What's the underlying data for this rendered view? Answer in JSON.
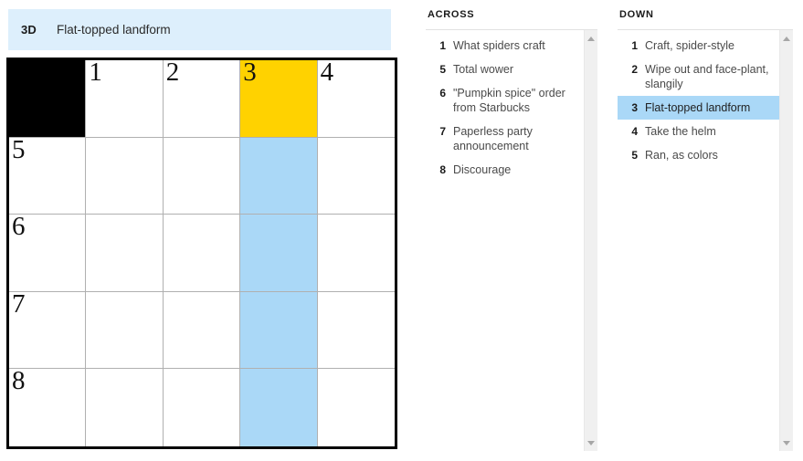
{
  "current_clue": {
    "ref": "3D",
    "text": "Flat-topped landform"
  },
  "colors": {
    "banner_bg": "#ddeffc",
    "cursor_cell": "#ffd200",
    "highlight_word": "#aad8f7",
    "block": "#000000",
    "grid_border": "#000000",
    "cell_border": "#b0b0b0"
  },
  "grid": {
    "rows": 5,
    "cols": 5,
    "cells": [
      {
        "number": "",
        "letter": "",
        "state": "block"
      },
      {
        "number": "1",
        "letter": "",
        "state": "empty"
      },
      {
        "number": "2",
        "letter": "",
        "state": "empty"
      },
      {
        "number": "3",
        "letter": "",
        "state": "cursor"
      },
      {
        "number": "4",
        "letter": "",
        "state": "empty"
      },
      {
        "number": "5",
        "letter": "",
        "state": "empty"
      },
      {
        "number": "",
        "letter": "",
        "state": "empty"
      },
      {
        "number": "",
        "letter": "",
        "state": "empty"
      },
      {
        "number": "",
        "letter": "",
        "state": "highlight"
      },
      {
        "number": "",
        "letter": "",
        "state": "empty"
      },
      {
        "number": "6",
        "letter": "",
        "state": "empty"
      },
      {
        "number": "",
        "letter": "",
        "state": "empty"
      },
      {
        "number": "",
        "letter": "",
        "state": "empty"
      },
      {
        "number": "",
        "letter": "",
        "state": "highlight"
      },
      {
        "number": "",
        "letter": "",
        "state": "empty"
      },
      {
        "number": "7",
        "letter": "",
        "state": "empty"
      },
      {
        "number": "",
        "letter": "",
        "state": "empty"
      },
      {
        "number": "",
        "letter": "",
        "state": "empty"
      },
      {
        "number": "",
        "letter": "",
        "state": "highlight"
      },
      {
        "number": "",
        "letter": "",
        "state": "empty"
      },
      {
        "number": "8",
        "letter": "",
        "state": "empty"
      },
      {
        "number": "",
        "letter": "",
        "state": "empty"
      },
      {
        "number": "",
        "letter": "",
        "state": "empty"
      },
      {
        "number": "",
        "letter": "",
        "state": "highlight"
      },
      {
        "number": "",
        "letter": "",
        "state": "empty"
      }
    ]
  },
  "across": {
    "title": "ACROSS",
    "clues": [
      {
        "number": "1",
        "text": "What spiders craft",
        "state": "cursor"
      },
      {
        "number": "5",
        "text": "Total wower",
        "state": "normal"
      },
      {
        "number": "6",
        "text": "\"Pumpkin spice\" order from Starbucks",
        "state": "normal"
      },
      {
        "number": "7",
        "text": "Paperless party announcement",
        "state": "normal"
      },
      {
        "number": "8",
        "text": "Discourage",
        "state": "normal"
      }
    ]
  },
  "down": {
    "title": "DOWN",
    "clues": [
      {
        "number": "1",
        "text": "Craft, spider-style",
        "state": "normal"
      },
      {
        "number": "2",
        "text": "Wipe out and face-plant, slangily",
        "state": "normal"
      },
      {
        "number": "3",
        "text": "Flat-topped landform",
        "state": "selected"
      },
      {
        "number": "4",
        "text": "Take the helm",
        "state": "normal"
      },
      {
        "number": "5",
        "text": "Ran, as colors",
        "state": "normal"
      }
    ]
  },
  "scrollbars": {
    "up_arrow_icon": "triangle-up-icon",
    "down_arrow_icon": "triangle-down-icon"
  }
}
